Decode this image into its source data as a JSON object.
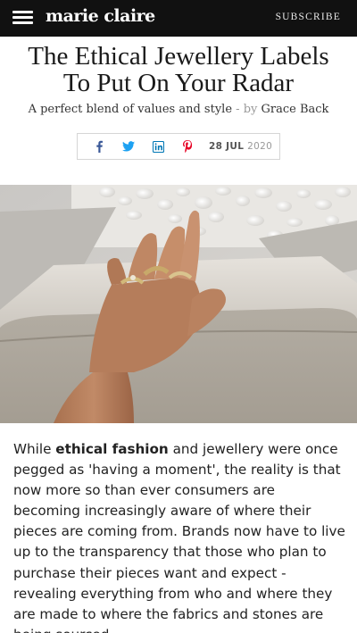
{
  "header": {
    "logo": "marie claire",
    "subscribe_label": "SUBSCRIBE",
    "menu_icon": "hamburger-menu-icon"
  },
  "article": {
    "headline": "The Ethical Jewellery Labels To Put On Your Radar",
    "dek": "A perfect blend of values and style",
    "separator": "-",
    "by": "by",
    "author": "Grace Back",
    "date_day_month": "28 JUL",
    "date_year": "2020",
    "share": {
      "icons": [
        "facebook-icon",
        "twitter-icon",
        "linkedin-icon",
        "pinterest-icon"
      ],
      "colors": {
        "facebook": "#3b5998",
        "twitter": "#1da1f2",
        "linkedin": "#0077b5",
        "pinterest": "#e60023"
      }
    },
    "hero_image": "hand-with-gold-rings-photo",
    "body_pre": "While ",
    "body_link": "ethical fashion",
    "body_post": " and jewellery were once pegged as 'having a moment', the reality is that now more so than ever consumers are becoming increasingly aware of where their pieces are coming from. Brands now have to live up to the transparency that those who plan to purchase their pieces want and expect - revealing everything from who and where they are made to where the fabrics and stones are being sourced."
  }
}
